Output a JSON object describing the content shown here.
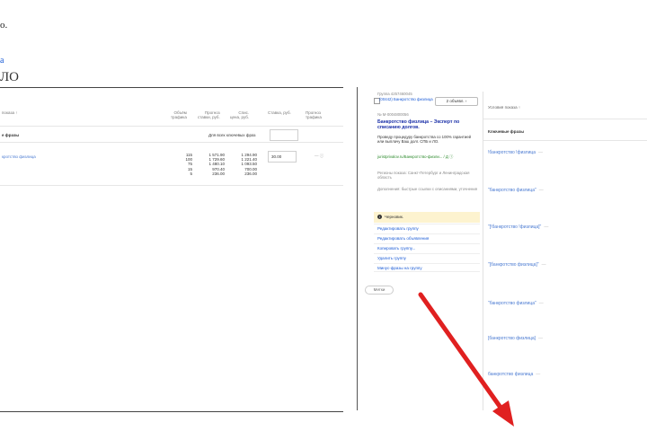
{
  "page_fragments": {
    "top_char": "о.",
    "link_char": "a",
    "label_text": "ЛО"
  },
  "left_panel": {
    "headers": {
      "conditions": "показа ↑",
      "volume": "Объём\nтрафика",
      "forecast_rate": "Прогноз\nставки, руб.",
      "charge_price": "Спис.\nцена, руб.",
      "rate": "Ставка, руб.",
      "forecast_traffic": "Прогноз\nтрафика"
    },
    "keyword_section": "е фразы",
    "all_phrases_label": "Для всех ключевых фраз",
    "keyword": "кротство физлица",
    "volumes": [
      "115",
      "100",
      "75",
      "15",
      "5"
    ],
    "forecast_rates": [
      "1 571.90",
      "1 729.60",
      "1 480.10",
      "970.40",
      "236.00"
    ],
    "charge_prices": [
      "1 294.90",
      "1 221.40",
      "1 093.50",
      "700.00",
      "236.00"
    ],
    "rate_value": "30.00",
    "traffic_symbol": "— ⓘ"
  },
  "group_card": {
    "group_id": "Группа 4257460045",
    "ad_count": "2 объявл. ›",
    "ad_ref": "(00442) Банкротство физлица",
    "ad_number": "№ М-0004800056",
    "ad_title": "Банкротство физлица – Эксперт по списанию долгов.",
    "ad_text": "Проведу процедуру банкротства со 100% гарантией или выплачу Ваш долг. СПБ и ЛО.",
    "display_url": "juristprivalov.ru/Банкротство-физли... / Д ⓘ",
    "regions": "Регионы показа: Санкт-Петербург и Ленинградская область",
    "extras": "Дополнения: быстрые ссылки с описаниями, уточнения",
    "status": "Черновик.",
    "menu": [
      "Редактировать группу",
      "Редактировать объявления",
      "Копировать группу...",
      "Удалить группу",
      "Минус-фразы на группу"
    ],
    "tags_label": "Метки"
  },
  "right_table": {
    "header": "Условия показа ↑",
    "section": "Ключевые фразы",
    "keywords": [
      "!банкротство !физлица",
      "\"банкротство физлица\"",
      "\"[!банкротство !физлица]\"",
      "\"[банкротство физлица]\"",
      "\"банкротство физлица\"",
      "[банкротство физлица]",
      "банкротство физлица"
    ],
    "dash": "—"
  },
  "colors": {
    "arrow": "#e02020",
    "link": "#1a5bd6",
    "ad_title": "#1a2fa8",
    "url_green": "#2c8a2c",
    "draft_bg": "#fdf3cf"
  }
}
